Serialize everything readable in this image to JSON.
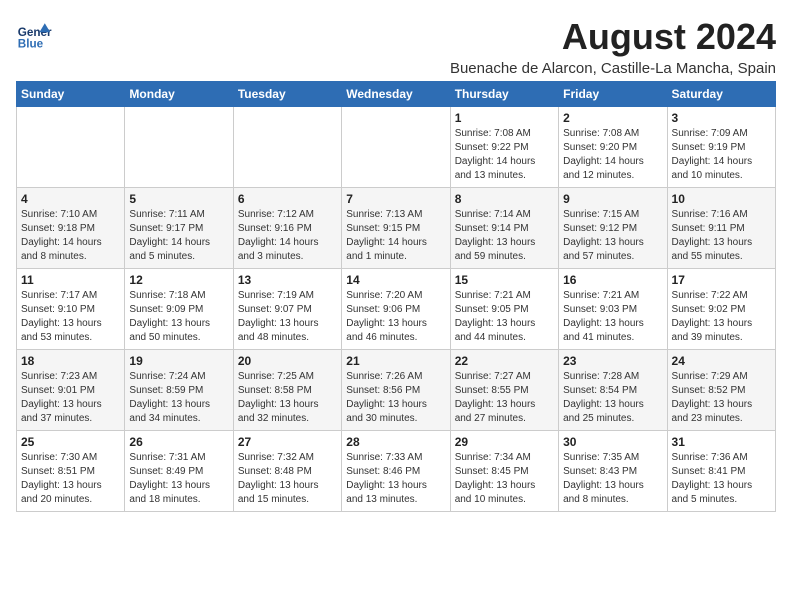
{
  "header": {
    "logo_text_top": "General",
    "logo_text_bottom": "Blue",
    "month_title": "August 2024",
    "location": "Buenache de Alarcon, Castille-La Mancha, Spain"
  },
  "weekdays": [
    "Sunday",
    "Monday",
    "Tuesday",
    "Wednesday",
    "Thursday",
    "Friday",
    "Saturday"
  ],
  "weeks": [
    [
      {
        "day": "",
        "info": ""
      },
      {
        "day": "",
        "info": ""
      },
      {
        "day": "",
        "info": ""
      },
      {
        "day": "",
        "info": ""
      },
      {
        "day": "1",
        "info": "Sunrise: 7:08 AM\nSunset: 9:22 PM\nDaylight: 14 hours\nand 13 minutes."
      },
      {
        "day": "2",
        "info": "Sunrise: 7:08 AM\nSunset: 9:20 PM\nDaylight: 14 hours\nand 12 minutes."
      },
      {
        "day": "3",
        "info": "Sunrise: 7:09 AM\nSunset: 9:19 PM\nDaylight: 14 hours\nand 10 minutes."
      }
    ],
    [
      {
        "day": "4",
        "info": "Sunrise: 7:10 AM\nSunset: 9:18 PM\nDaylight: 14 hours\nand 8 minutes."
      },
      {
        "day": "5",
        "info": "Sunrise: 7:11 AM\nSunset: 9:17 PM\nDaylight: 14 hours\nand 5 minutes."
      },
      {
        "day": "6",
        "info": "Sunrise: 7:12 AM\nSunset: 9:16 PM\nDaylight: 14 hours\nand 3 minutes."
      },
      {
        "day": "7",
        "info": "Sunrise: 7:13 AM\nSunset: 9:15 PM\nDaylight: 14 hours\nand 1 minute."
      },
      {
        "day": "8",
        "info": "Sunrise: 7:14 AM\nSunset: 9:14 PM\nDaylight: 13 hours\nand 59 minutes."
      },
      {
        "day": "9",
        "info": "Sunrise: 7:15 AM\nSunset: 9:12 PM\nDaylight: 13 hours\nand 57 minutes."
      },
      {
        "day": "10",
        "info": "Sunrise: 7:16 AM\nSunset: 9:11 PM\nDaylight: 13 hours\nand 55 minutes."
      }
    ],
    [
      {
        "day": "11",
        "info": "Sunrise: 7:17 AM\nSunset: 9:10 PM\nDaylight: 13 hours\nand 53 minutes."
      },
      {
        "day": "12",
        "info": "Sunrise: 7:18 AM\nSunset: 9:09 PM\nDaylight: 13 hours\nand 50 minutes."
      },
      {
        "day": "13",
        "info": "Sunrise: 7:19 AM\nSunset: 9:07 PM\nDaylight: 13 hours\nand 48 minutes."
      },
      {
        "day": "14",
        "info": "Sunrise: 7:20 AM\nSunset: 9:06 PM\nDaylight: 13 hours\nand 46 minutes."
      },
      {
        "day": "15",
        "info": "Sunrise: 7:21 AM\nSunset: 9:05 PM\nDaylight: 13 hours\nand 44 minutes."
      },
      {
        "day": "16",
        "info": "Sunrise: 7:21 AM\nSunset: 9:03 PM\nDaylight: 13 hours\nand 41 minutes."
      },
      {
        "day": "17",
        "info": "Sunrise: 7:22 AM\nSunset: 9:02 PM\nDaylight: 13 hours\nand 39 minutes."
      }
    ],
    [
      {
        "day": "18",
        "info": "Sunrise: 7:23 AM\nSunset: 9:01 PM\nDaylight: 13 hours\nand 37 minutes."
      },
      {
        "day": "19",
        "info": "Sunrise: 7:24 AM\nSunset: 8:59 PM\nDaylight: 13 hours\nand 34 minutes."
      },
      {
        "day": "20",
        "info": "Sunrise: 7:25 AM\nSunset: 8:58 PM\nDaylight: 13 hours\nand 32 minutes."
      },
      {
        "day": "21",
        "info": "Sunrise: 7:26 AM\nSunset: 8:56 PM\nDaylight: 13 hours\nand 30 minutes."
      },
      {
        "day": "22",
        "info": "Sunrise: 7:27 AM\nSunset: 8:55 PM\nDaylight: 13 hours\nand 27 minutes."
      },
      {
        "day": "23",
        "info": "Sunrise: 7:28 AM\nSunset: 8:54 PM\nDaylight: 13 hours\nand 25 minutes."
      },
      {
        "day": "24",
        "info": "Sunrise: 7:29 AM\nSunset: 8:52 PM\nDaylight: 13 hours\nand 23 minutes."
      }
    ],
    [
      {
        "day": "25",
        "info": "Sunrise: 7:30 AM\nSunset: 8:51 PM\nDaylight: 13 hours\nand 20 minutes."
      },
      {
        "day": "26",
        "info": "Sunrise: 7:31 AM\nSunset: 8:49 PM\nDaylight: 13 hours\nand 18 minutes."
      },
      {
        "day": "27",
        "info": "Sunrise: 7:32 AM\nSunset: 8:48 PM\nDaylight: 13 hours\nand 15 minutes."
      },
      {
        "day": "28",
        "info": "Sunrise: 7:33 AM\nSunset: 8:46 PM\nDaylight: 13 hours\nand 13 minutes."
      },
      {
        "day": "29",
        "info": "Sunrise: 7:34 AM\nSunset: 8:45 PM\nDaylight: 13 hours\nand 10 minutes."
      },
      {
        "day": "30",
        "info": "Sunrise: 7:35 AM\nSunset: 8:43 PM\nDaylight: 13 hours\nand 8 minutes."
      },
      {
        "day": "31",
        "info": "Sunrise: 7:36 AM\nSunset: 8:41 PM\nDaylight: 13 hours\nand 5 minutes."
      }
    ]
  ]
}
